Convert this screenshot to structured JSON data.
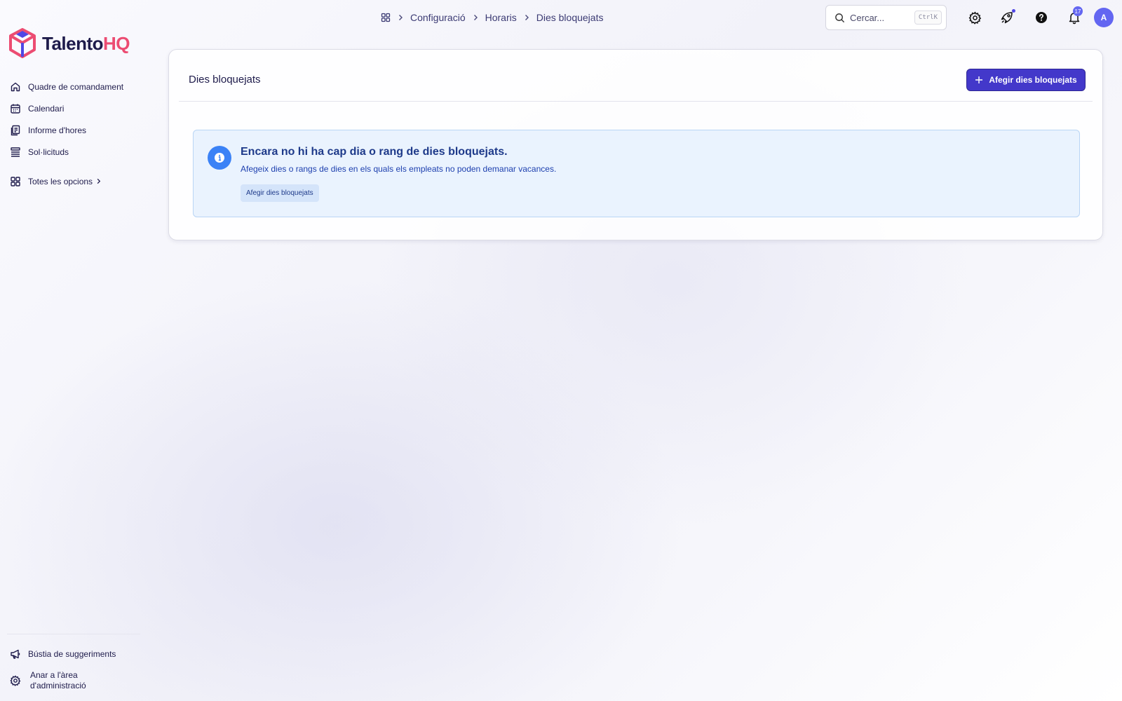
{
  "app": {
    "logo_part1": "Talento",
    "logo_part2": "HQ",
    "brand_color": "#ec4c72",
    "accent_color": "#4338ca"
  },
  "sidebar": {
    "items": [
      {
        "label": "Quadre de comandament",
        "icon": "home-icon"
      },
      {
        "label": "Calendari",
        "icon": "calendar-icon"
      },
      {
        "label": "Informe d'hores",
        "icon": "report-icon"
      },
      {
        "label": "Sol·licituds",
        "icon": "list-icon"
      }
    ],
    "more_label": "Totes les opcions",
    "bottom": {
      "feedback_label": "Bústia de suggeriments",
      "admin_label_line1": "Anar a l'àrea",
      "admin_label_line2": "d'administració"
    }
  },
  "header": {
    "breadcrumb": [
      "Configuració",
      "Horaris",
      "Dies bloquejats"
    ],
    "search_placeholder": "Cercar...",
    "search_shortcut": "CtrlK",
    "notification_count": "17",
    "avatar_initial": "A"
  },
  "main": {
    "title": "Dies bloquejats",
    "add_button_label": "Afegir dies bloquejats",
    "empty_state": {
      "title": "Encara no hi ha cap dia o rang de dies bloquejats.",
      "text": "Afegeix dies o rangs de dies en els quals els empleats no poden demanar vacances.",
      "button_label": "Afegir dies bloquejats"
    }
  }
}
